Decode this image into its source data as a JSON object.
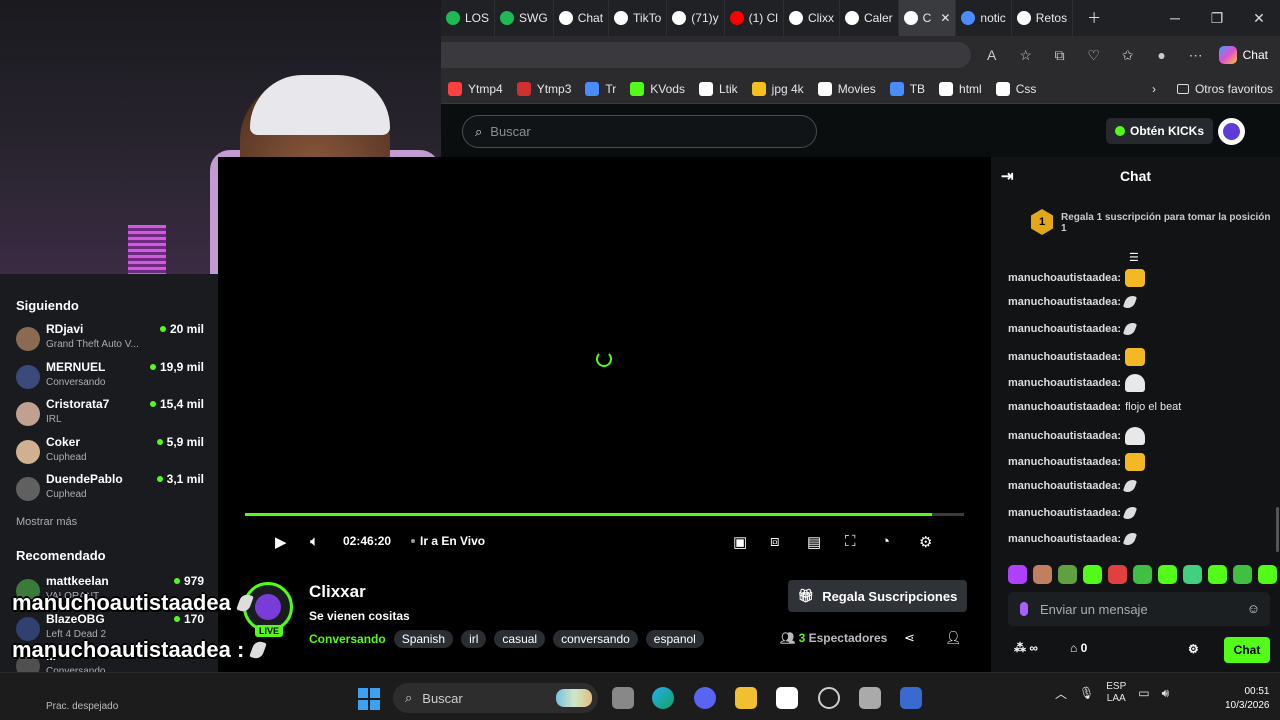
{
  "browser": {
    "tabs": [
      {
        "label": "LOS",
        "icon": "green-circle-icon",
        "color": "#1db954"
      },
      {
        "label": "SWG",
        "icon": "spotify-icon",
        "color": "#1db954"
      },
      {
        "label": "Chat",
        "icon": "openai-icon",
        "color": "#ffffff"
      },
      {
        "label": "TikTo",
        "icon": "tiktok-icon",
        "color": "#ffffff"
      },
      {
        "label": "(71)y",
        "icon": "tiktok-icon",
        "color": "#ffffff"
      },
      {
        "label": "(1) Cl",
        "icon": "youtube-icon",
        "color": "#ff0000"
      },
      {
        "label": "Clixx",
        "icon": "tiktok-icon",
        "color": "#ffffff"
      },
      {
        "label": "Caler",
        "icon": "infinity-icon",
        "color": "#ffffff"
      },
      {
        "label": "C",
        "icon": "speaker-icon",
        "color": "#ffffff",
        "active": true
      },
      {
        "label": "notic",
        "icon": "search-icon",
        "color": "#4a8cff"
      },
      {
        "label": "Retos",
        "icon": "notion-icon",
        "color": "#ffffff"
      }
    ],
    "bookmarks": [
      {
        "label": "Ytmp4",
        "color": "#ff4040"
      },
      {
        "label": "Ytmp3",
        "color": "#d03030"
      },
      {
        "label": "Tr",
        "color": "#4a8cff"
      },
      {
        "label": "KVods",
        "color": "#53fc18"
      },
      {
        "label": "Ltik",
        "color": "#ffffff"
      },
      {
        "label": "jpg 4k",
        "color": "#f3c020"
      },
      {
        "label": "Movies",
        "color": "#ffffff"
      },
      {
        "label": "TB",
        "color": "#4a8cff"
      },
      {
        "label": "html",
        "color": "#ffffff"
      },
      {
        "label": "Css",
        "color": "#ffffff"
      }
    ],
    "other_bookmarks": "Otros favoritos",
    "copilot_label": "Chat"
  },
  "site": {
    "search_placeholder": "Buscar",
    "kicks_button": "Obtén KICKs"
  },
  "sidebar": {
    "following_title": "Siguiendo",
    "following": [
      {
        "name": "RDjavi",
        "category": "Grand Theft Auto V...",
        "viewers": "20 mil",
        "color": "#8a6a50"
      },
      {
        "name": "MERNUEL",
        "category": "Conversando",
        "viewers": "19,9 mil",
        "color": "#3a4a7a"
      },
      {
        "name": "Cristorata7",
        "category": "IRL",
        "viewers": "15,4 mil",
        "color": "#c0a090"
      },
      {
        "name": "Coker",
        "category": "Cuphead",
        "viewers": "5,9 mil",
        "color": "#d0b090"
      },
      {
        "name": "DuendePablo",
        "category": "Cuphead",
        "viewers": "3,1 mil",
        "color": "#606060"
      }
    ],
    "show_more": "Mostrar más",
    "recommended_title": "Recomendado",
    "recommended": [
      {
        "name": "mattkeelan",
        "category": "VALORANT",
        "viewers": "979",
        "color": "#3a7a3a"
      },
      {
        "name": "BlazeOBG",
        "category": "Left 4 Dead 2",
        "viewers": "170",
        "color": "#304070"
      },
      {
        "name": "...",
        "category": "Conversando",
        "viewers": "",
        "color": "#505050"
      }
    ]
  },
  "player": {
    "time": "02:46:20",
    "go_live": "Ir a En Vivo",
    "progress": 0.955
  },
  "stream": {
    "streamer": "Clixxar",
    "title": "Se vienen cositas",
    "live_badge": "LIVE",
    "category": "Conversando",
    "tags": [
      "Spanish",
      "irl",
      "casual",
      "conversando",
      "espanol"
    ],
    "gift_button": "Regala Suscripciones",
    "viewer_count": "3",
    "viewer_label": "Espectadores"
  },
  "chat": {
    "title": "Chat",
    "pinned_rank": "1",
    "pinned_text": "Regala 1 suscripción para tomar la posición 1",
    "messages": [
      {
        "user": "manuchoautistaadea:",
        "text": "",
        "emote": "cat"
      },
      {
        "user": "manuchoautistaadea:",
        "text": "",
        "emote": "feather"
      },
      {
        "user": "manuchoautistaadea:",
        "text": "",
        "emote": "feather"
      },
      {
        "user": "manuchoautistaadea:",
        "text": "",
        "emote": "cat"
      },
      {
        "user": "manuchoautistaadea:",
        "text": "",
        "emote": "ghost"
      },
      {
        "user": "manuchoautistaadea:",
        "text": "flojo el beat",
        "emote": ""
      },
      {
        "user": "manuchoautistaadea:",
        "text": "",
        "emote": "ghost"
      },
      {
        "user": "manuchoautistaadea:",
        "text": "",
        "emote": "cat"
      },
      {
        "user": "manuchoautistaadea:",
        "text": "",
        "emote": "feather"
      },
      {
        "user": "manuchoautistaadea:",
        "text": "",
        "emote": "feather"
      },
      {
        "user": "manuchoautistaadea:",
        "text": "",
        "emote": "feather"
      }
    ],
    "emote_colors": [
      "#b040ff",
      "#c08060",
      "#60a040",
      "#53fc18",
      "#e04040",
      "#40c040",
      "#53fc18",
      "#40d080",
      "#53fc18",
      "#40c040",
      "#53fc18"
    ],
    "input_placeholder": "Enviar un mensaje",
    "points": "∞",
    "gift_count": "0",
    "send_button": "Chat"
  },
  "overlay_captions": [
    {
      "text": "manuchoautistaadea"
    },
    {
      "text": "manuchoautistaadea :"
    },
    {
      "text": "manuchoautistaadea :"
    }
  ],
  "taskbar": {
    "weather": "Prac. despejado",
    "search_placeholder": "Buscar",
    "lang_top": "ESP",
    "lang_bottom": "LAA",
    "time": "00:51",
    "date": "10/3/2026"
  }
}
